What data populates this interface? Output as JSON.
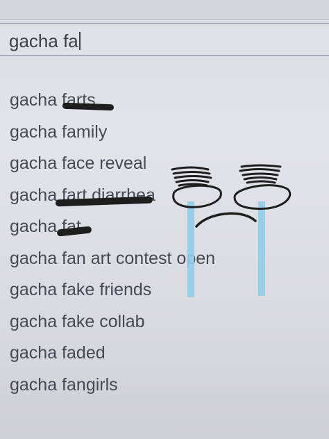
{
  "search": {
    "query": "gacha fa"
  },
  "suggestions": [
    {
      "label": "gacha farts"
    },
    {
      "label": "gacha family"
    },
    {
      "label": "gacha face reveal"
    },
    {
      "label": "gacha fart diarrhea"
    },
    {
      "label": "gacha fat"
    },
    {
      "label": "gacha fan art contest open"
    },
    {
      "label": "gacha fake friends"
    },
    {
      "label": "gacha fake collab"
    },
    {
      "label": "gacha faded"
    },
    {
      "label": "gacha fangirls"
    }
  ],
  "colors": {
    "text": "#464a55",
    "tears": "#8fcdea",
    "ink": "#1e1e1e"
  }
}
